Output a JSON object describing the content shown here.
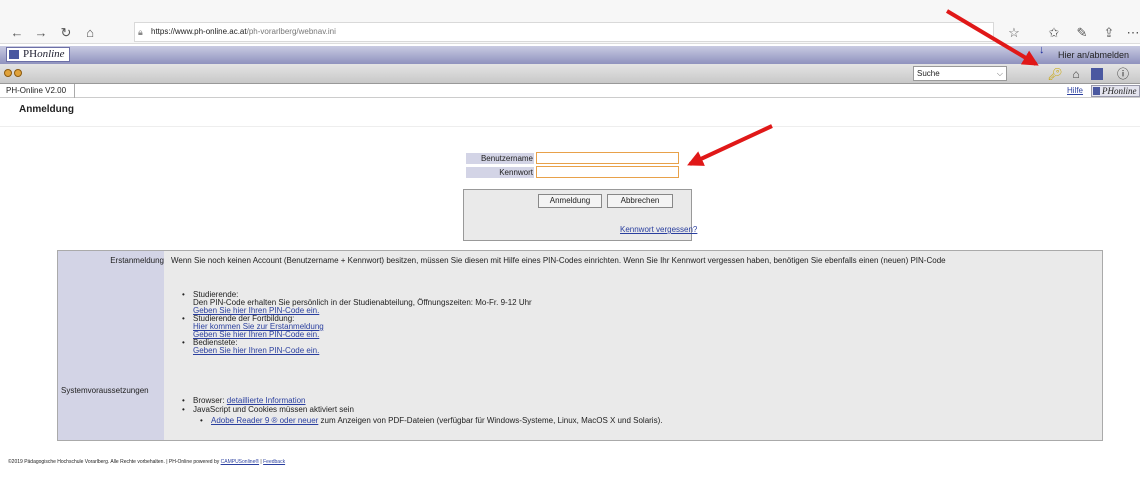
{
  "browser": {
    "url_host": "https://www.ph-online.ac.at",
    "url_path": "/ph-vorarlberg/webnav.ini"
  },
  "phonline": {
    "logo_prefix": "PH",
    "logo_suffix": "online",
    "signin_label": "Hier an/abmelden",
    "search_label": "Suche",
    "tab_version": "PH-Online V2.00",
    "help_link": "Hilfe",
    "mini_logo_prefix": "PH",
    "mini_logo_suffix": "online"
  },
  "page": {
    "title": "Anmeldung"
  },
  "login": {
    "username_label": "Benutzername",
    "password_label": "Kennwort",
    "submit_label": "Anmeldung",
    "cancel_label": "Abbrechen",
    "forgot_link": "Kennwort vergessen?"
  },
  "info": {
    "first_login_label": "Erstanmeldung",
    "first_login_text": "Wenn Sie noch keinen Account (Benutzername + Kennwort) besitzen, müssen Sie diesen mit Hilfe eines PIN-Codes einrichten. Wenn Sie Ihr Kennwort vergessen haben, benötigen Sie ebenfalls einen (neuen) PIN-Code",
    "students_label": "Studierende:",
    "students_text": "Den PIN-Code erhalten Sie persönlich in der Studienabteilung, Öffnungszeiten: Mo-Fr. 9-12 Uhr",
    "students_link": "Geben Sie hier Ihren PIN-Code ein.",
    "further_ed_label": "Studierende der Fortbildung:",
    "further_ed_link1": "Hier kommen Sie zur Erstanmeldung",
    "further_ed_link2": "Geben Sie hier Ihren PIN-Code ein.",
    "staff_label": "Bedienstete:",
    "staff_link": "Geben Sie hier Ihren PIN-Code ein.",
    "sysreq_label": "Systemvoraussetzungen",
    "browser_prefix": "Browser:",
    "browser_link": "detaillierte Information",
    "js_text": "JavaScript und Cookies müssen aktiviert sein",
    "adobe_link": "Adobe Reader 9 ® oder neuer",
    "adobe_text": "zum Anzeigen von PDF-Dateien (verfügbar für Windows-Systeme, Linux, MacOS X und Solaris)."
  },
  "footer": {
    "text": "©2019 Pädagogische Hochschule Vorarlberg. Alle Rechte vorbehalten. | PH-Online powered by",
    "campus_link": "CAMPUSonline®",
    "feedback_link": "Feedback"
  },
  "colors": {
    "annotation_arrow": "#e01818",
    "label_bg": "#d3d4e6",
    "link": "#2a3f9f"
  }
}
